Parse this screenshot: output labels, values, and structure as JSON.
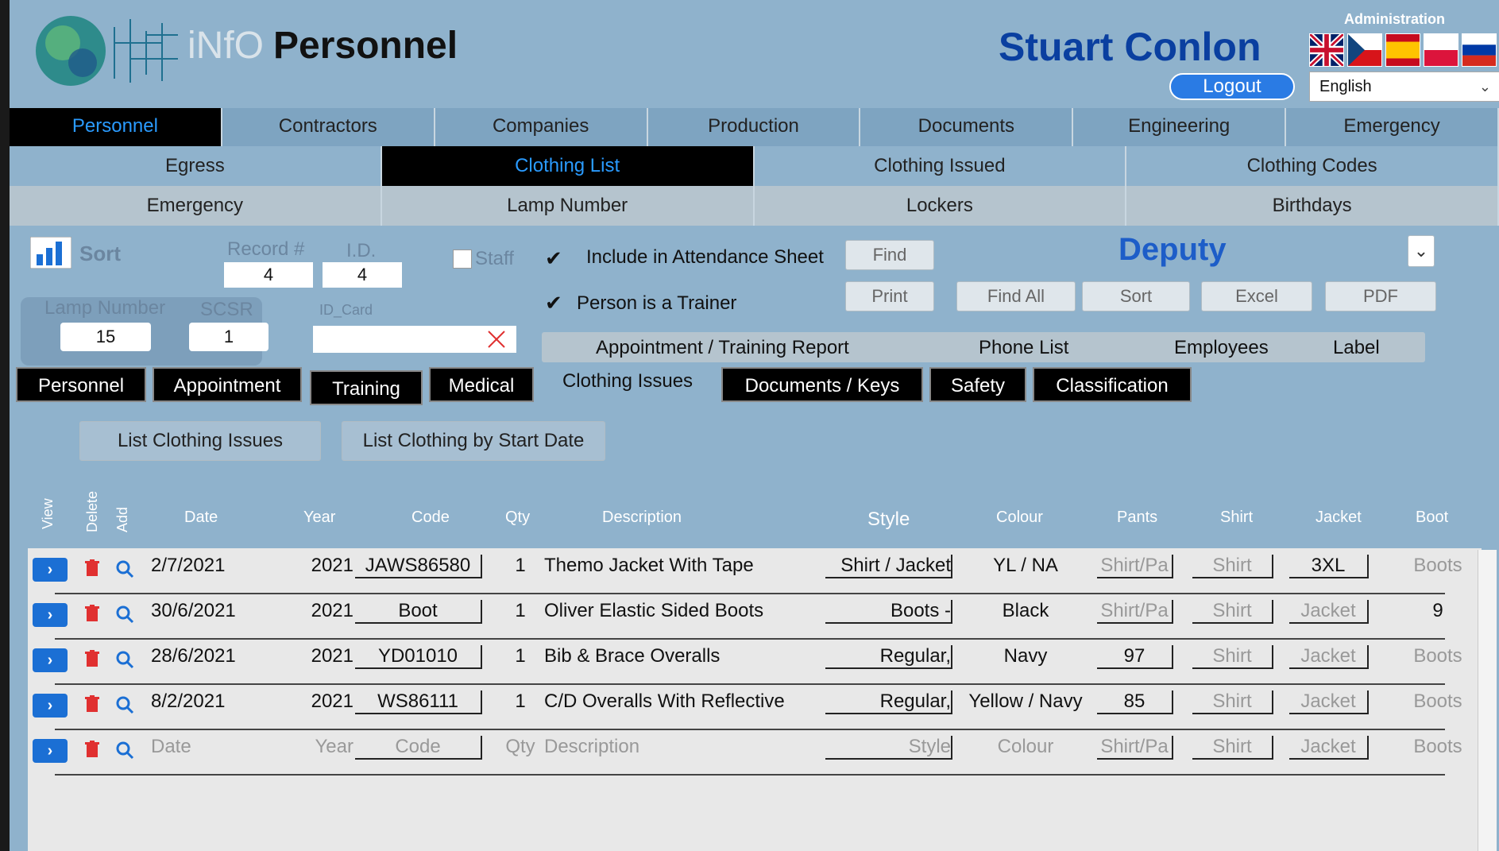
{
  "app": {
    "brand": "iNfO",
    "title": "Personnel",
    "user": "Stuart Conlon",
    "logout": "Logout",
    "admin": "Administration",
    "language": "English"
  },
  "nav": {
    "row1": [
      "Personnel",
      "Contractors",
      "Companies",
      "Production",
      "Documents",
      "Engineering",
      "Emergency"
    ],
    "row2": [
      "Egress",
      "Clothing List",
      "Clothing Issued",
      "Clothing Codes"
    ],
    "row3": [
      "Emergency",
      "Lamp Number",
      "Lockers",
      "Birthdays"
    ]
  },
  "form": {
    "sort": "Sort",
    "record_label": "Record #",
    "record": "4",
    "id_label": "I.D.",
    "id": "4",
    "staff": "Staff",
    "include": "Include in Attendance Sheet",
    "trainer": "Person is a Trainer",
    "lamp_label": "Lamp Number",
    "lamp": "15",
    "scsr_label": "SCSR",
    "scsr": "1",
    "idcard_label": "ID_Card",
    "find": "Find",
    "print": "Print",
    "findall": "Find All",
    "sortbtn": "Sort",
    "excel": "Excel",
    "pdf": "PDF",
    "deputy": "Deputy",
    "reports": [
      "Appointment / Training Report",
      "Phone List",
      "Employees",
      "Label"
    ]
  },
  "tabs": [
    "Personnel",
    "Appointment",
    "Training",
    "Medical",
    "Clothing Issues",
    "Documents / Keys",
    "Safety",
    "Classification"
  ],
  "buttons": {
    "list_issues": "List Clothing Issues",
    "list_by_date": "List Clothing by Start Date"
  },
  "table": {
    "headers": {
      "view": "View",
      "delete": "Delete",
      "add": "Add",
      "date": "Date",
      "year": "Year",
      "code": "Code",
      "qty": "Qty",
      "description": "Description",
      "style": "Style",
      "colour": "Colour",
      "pants": "Pants",
      "shirt": "Shirt",
      "jacket": "Jacket",
      "boot": "Boot"
    },
    "rows": [
      {
        "date": "2/7/2021",
        "year": "2021",
        "code": "JAWS86580",
        "qty": "1",
        "desc": "Themo Jacket With Tape",
        "style": "Shirt / Jacket",
        "colour": "YL / NA",
        "pants": "Shirt/Pa",
        "shirt": "Shirt",
        "jacket": "3XL",
        "boot": "Boots"
      },
      {
        "date": "30/6/2021",
        "year": "2021",
        "code": "Boot",
        "qty": "1",
        "desc": "Oliver Elastic Sided Boots",
        "style": "Boots -",
        "colour": "Black",
        "pants": "Shirt/Pa",
        "shirt": "Shirt",
        "jacket": "Jacket",
        "boot": "9"
      },
      {
        "date": "28/6/2021",
        "year": "2021",
        "code": "YD01010",
        "qty": "1",
        "desc": "Bib & Brace Overalls",
        "style": "Regular,",
        "colour": "Navy",
        "pants": "97",
        "shirt": "Shirt",
        "jacket": "Jacket",
        "boot": "Boots"
      },
      {
        "date": "8/2/2021",
        "year": "2021",
        "code": "WS86111",
        "qty": "1",
        "desc": "C/D Overalls With Reflective",
        "style": "Regular,",
        "colour": "Yellow / Navy",
        "pants": "85",
        "shirt": "Shirt",
        "jacket": "Jacket",
        "boot": "Boots"
      },
      {
        "date": "Date",
        "year": "Year",
        "code": "Code",
        "qty": "Qty",
        "desc": "Description",
        "style": "Style",
        "colour": "Colour",
        "pants": "Shirt/Pa",
        "shirt": "Shirt",
        "jacket": "Jacket",
        "boot": "Boots"
      }
    ]
  }
}
